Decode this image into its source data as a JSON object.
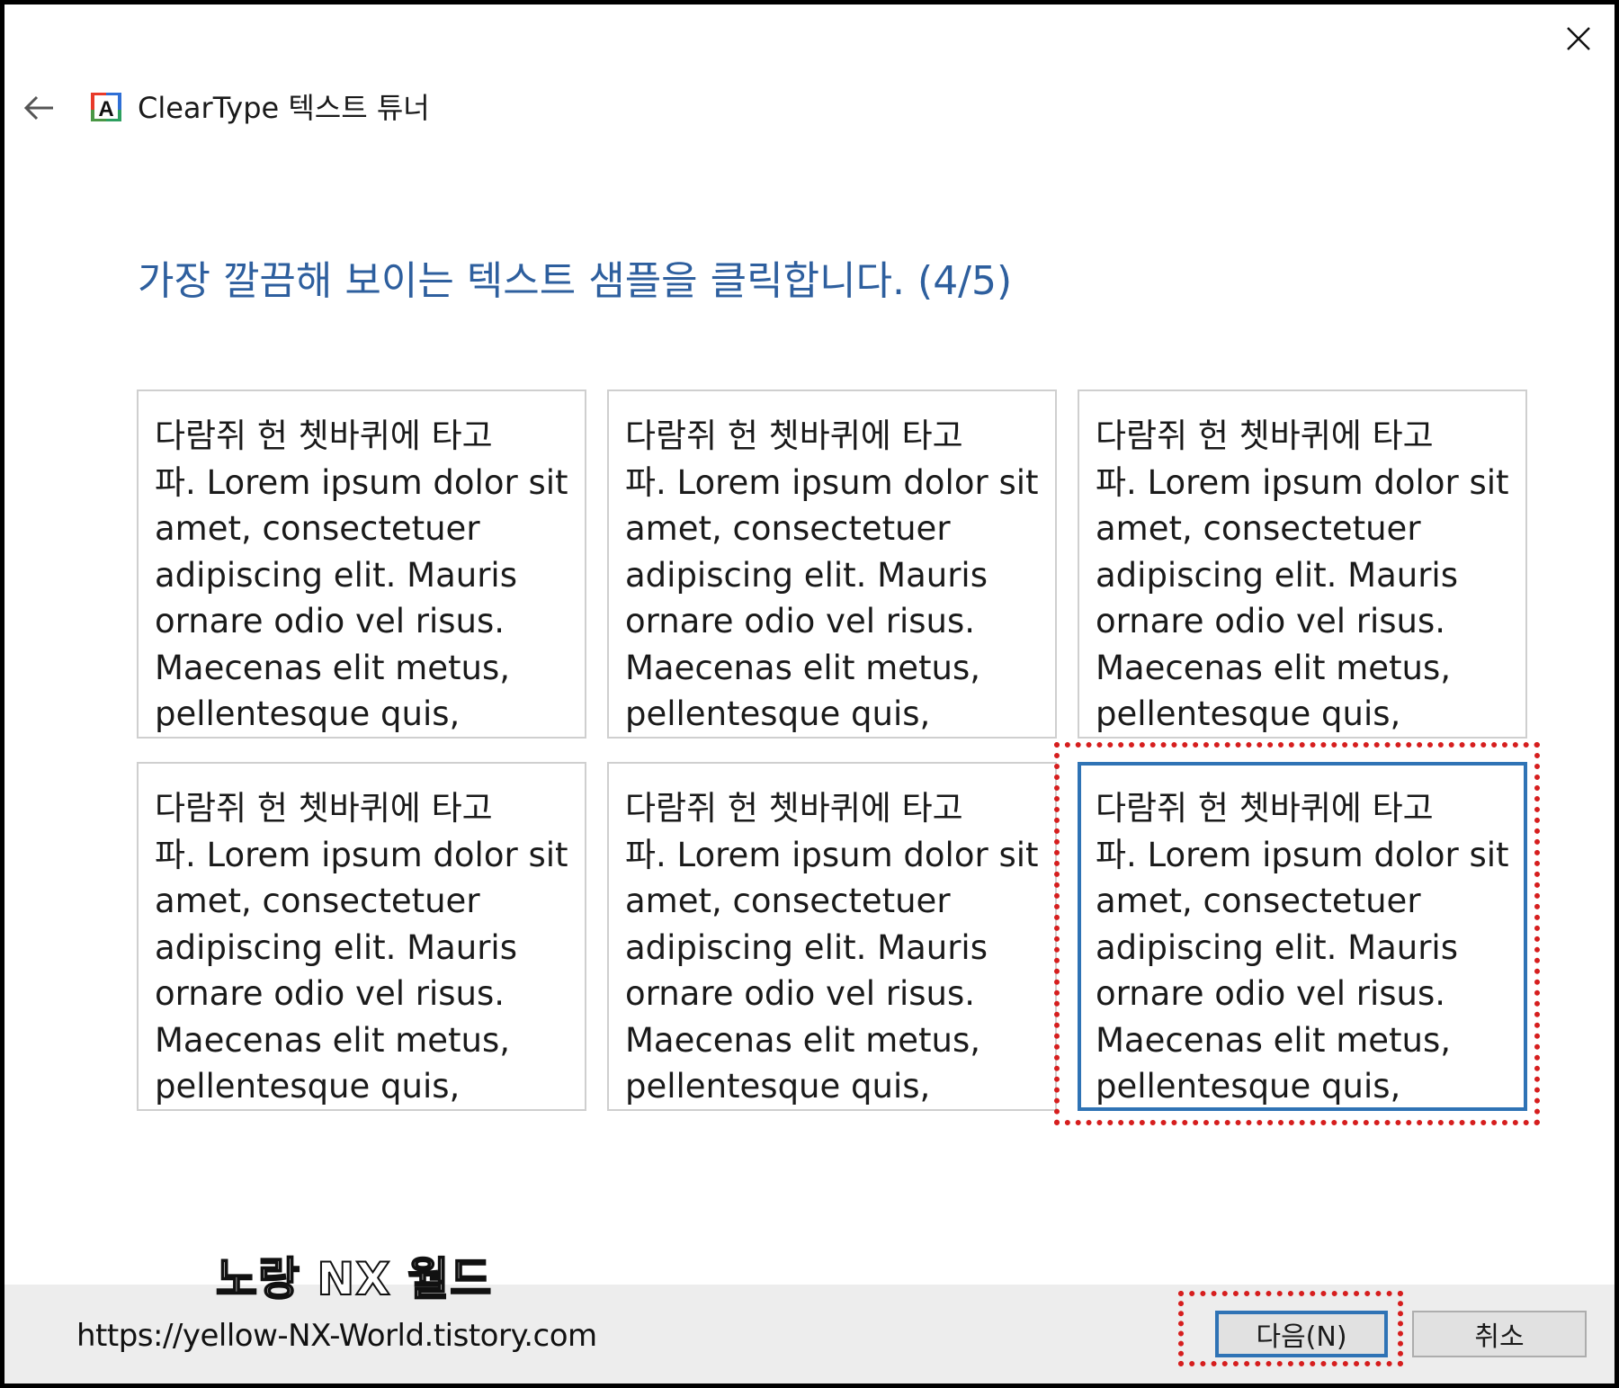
{
  "window": {
    "title": "ClearType 텍스트 튜너",
    "close_icon": "close-icon",
    "back_icon": "arrow-left-icon",
    "app_icon": "cleartype-a-icon"
  },
  "instruction": "가장 깔끔해 보이는 텍스트 샘플을 클릭합니다. (4/5)",
  "samples": [
    {
      "text": "다람쥐 헌 쳇바퀴에 타고\n파. Lorem ipsum dolor sit\namet, consectetuer\nadipiscing elit. Mauris\nornare odio vel risus.\nMaecenas elit metus,\npellentesque quis,",
      "selected": false
    },
    {
      "text": "다람쥐 헌 쳇바퀴에 타고\n파. Lorem ipsum dolor sit\namet, consectetuer\nadipiscing elit. Mauris\nornare odio vel risus.\nMaecenas elit metus,\npellentesque quis,",
      "selected": false
    },
    {
      "text": "다람쥐 헌 쳇바퀴에 타고\n파. Lorem ipsum dolor sit\namet, consectetuer\nadipiscing elit. Mauris\nornare odio vel risus.\nMaecenas elit metus,\npellentesque quis,",
      "selected": false
    },
    {
      "text": "다람쥐 헌 쳇바퀴에 타고\n파. Lorem ipsum dolor sit\namet, consectetuer\nadipiscing elit. Mauris\nornare odio vel risus.\nMaecenas elit metus,\npellentesque quis,",
      "selected": false
    },
    {
      "text": "다람쥐 헌 쳇바퀴에 타고\n파. Lorem ipsum dolor sit\namet, consectetuer\nadipiscing elit. Mauris\nornare odio vel risus.\nMaecenas elit metus,\npellentesque quis,",
      "selected": false
    },
    {
      "text": "다람쥐 헌 쳇바퀴에 타고\n파. Lorem ipsum dolor sit\namet, consectetuer\nadipiscing elit. Mauris\nornare odio vel risus.\nMaecenas elit metus,\npellentesque quis,",
      "selected": true
    }
  ],
  "footer": {
    "next_label": "다음(N)",
    "cancel_label": "취소"
  },
  "watermark": {
    "title": "노랑 NX 월드",
    "url": "https://yellow-NX-World.tistory.com"
  },
  "colors": {
    "accent": "#2f73b5",
    "instruction": "#2e5f9e",
    "highlight": "#d61e1e",
    "footer_bg": "#ededed"
  }
}
